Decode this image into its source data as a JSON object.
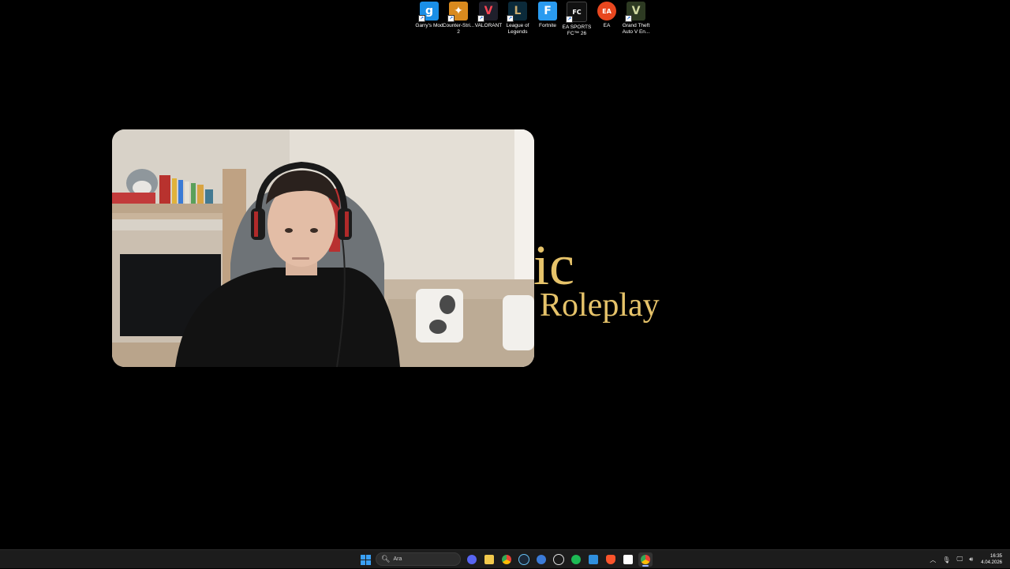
{
  "desktop_icons": [
    {
      "label": "Garry's Mod",
      "icon": "garrys-mod-icon",
      "glyph": "g",
      "color": "#1a8fe6"
    },
    {
      "label": "Counter-Stri... 2",
      "icon": "counter-strike-icon",
      "glyph": "✦",
      "color": "#d98a1e"
    },
    {
      "label": "VALORANT",
      "icon": "valorant-icon",
      "glyph": "V",
      "color": "#fa4454"
    },
    {
      "label": "League of Legends",
      "icon": "league-of-legends-icon",
      "glyph": "L",
      "color": "#c8aa6e"
    },
    {
      "label": "Fortnite",
      "icon": "fortnite-icon",
      "glyph": "F",
      "color": "#2a9bf0"
    },
    {
      "label": "EA SPORTS FC™ 26",
      "icon": "ea-sports-fc-icon",
      "glyph": "FC",
      "color": "#111111"
    },
    {
      "label": "EA",
      "icon": "ea-icon",
      "glyph": "EA",
      "color": "#e8471f"
    },
    {
      "label": "Grand Theft Auto V En...",
      "icon": "gta-v-icon",
      "glyph": "V",
      "color": "#5a6b3c"
    }
  ],
  "background_title": {
    "line1": "ic",
    "line2": "Roleplay",
    "color": "#e6c36a"
  },
  "taskbar": {
    "search_placeholder": "Ara",
    "apps": [
      {
        "name": "discord-icon",
        "color": "#5865f2"
      },
      {
        "name": "file-explorer-icon",
        "color": "#f2c94c"
      },
      {
        "name": "chrome-icon",
        "color": "#34a853"
      },
      {
        "name": "steam-icon",
        "color": "#66c0f4"
      },
      {
        "name": "app-blue-icon",
        "color": "#3b7bd8"
      },
      {
        "name": "chatgpt-icon",
        "color": "#e0e0e0"
      },
      {
        "name": "spotify-icon",
        "color": "#1db954"
      },
      {
        "name": "vscode-icon",
        "color": "#2f8fdd"
      },
      {
        "name": "brave-icon",
        "color": "#fb542b"
      },
      {
        "name": "notion-icon",
        "color": "#ffffff"
      },
      {
        "name": "chrome-active-icon",
        "color": "#ea4335"
      }
    ],
    "clock_time": "16:35",
    "clock_date": "4.04.2026"
  }
}
